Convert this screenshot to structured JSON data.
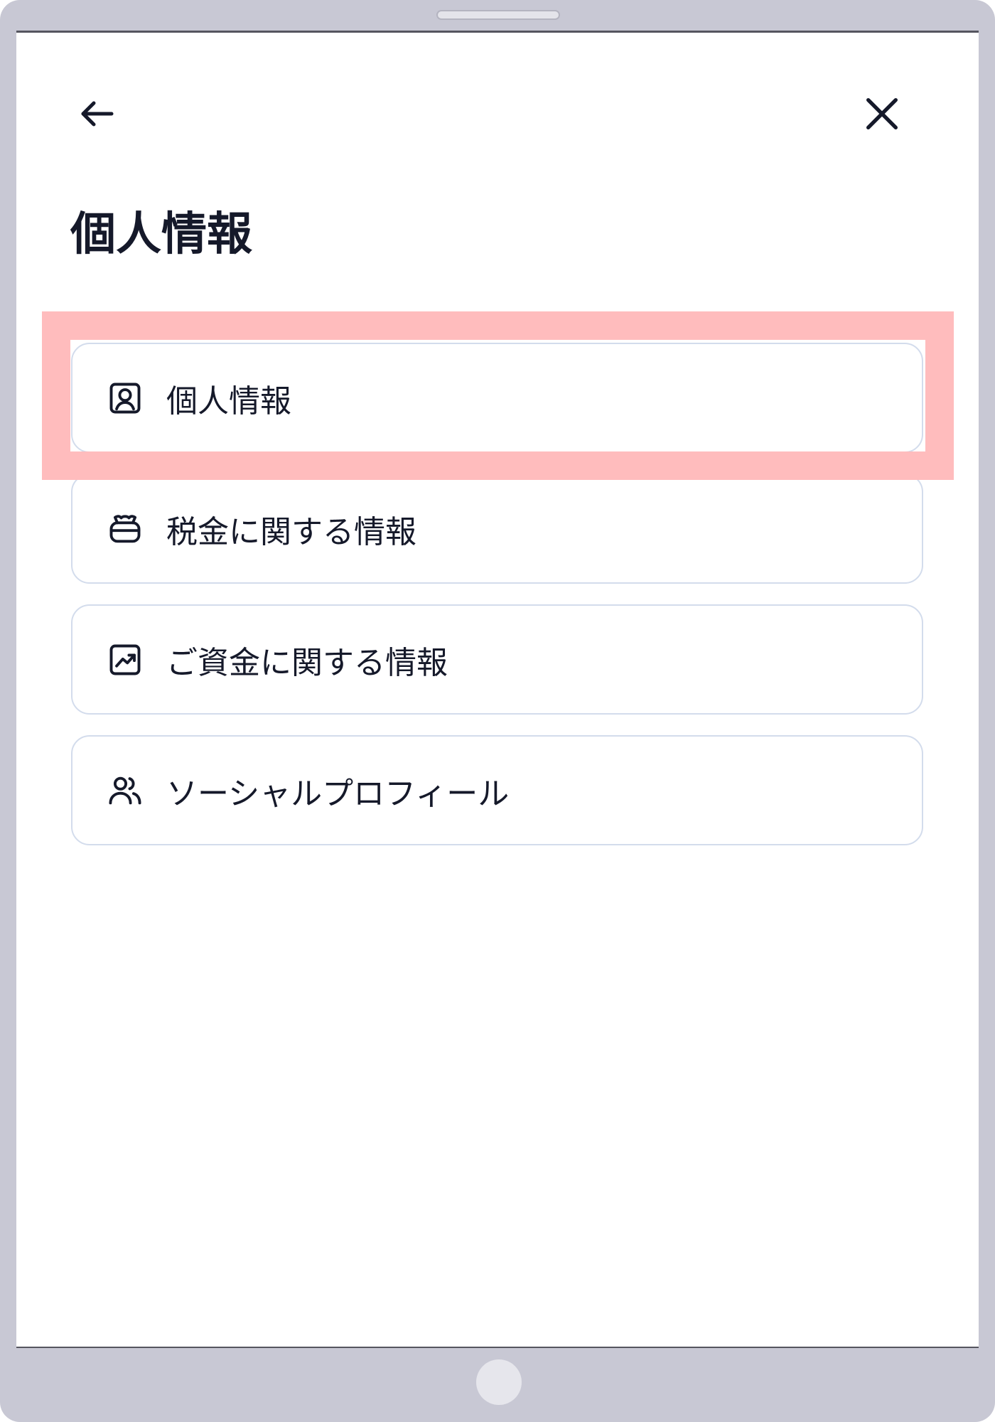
{
  "header": {
    "back_icon": "arrow-left-icon",
    "close_icon": "close-icon"
  },
  "page": {
    "title": "個人情報"
  },
  "menu": {
    "items": [
      {
        "label": "個人情報",
        "icon": "id-card-icon"
      },
      {
        "label": "税金に関する情報",
        "icon": "money-bag-icon"
      },
      {
        "label": "ご資金に関する情報",
        "icon": "chart-trend-icon"
      },
      {
        "label": "ソーシャルプロフィール",
        "icon": "users-icon"
      }
    ]
  },
  "colors": {
    "text": "#15192a",
    "card_border": "#d3dcec",
    "highlight": "#ffbcbd",
    "device_frame": "#c8c8d4"
  }
}
